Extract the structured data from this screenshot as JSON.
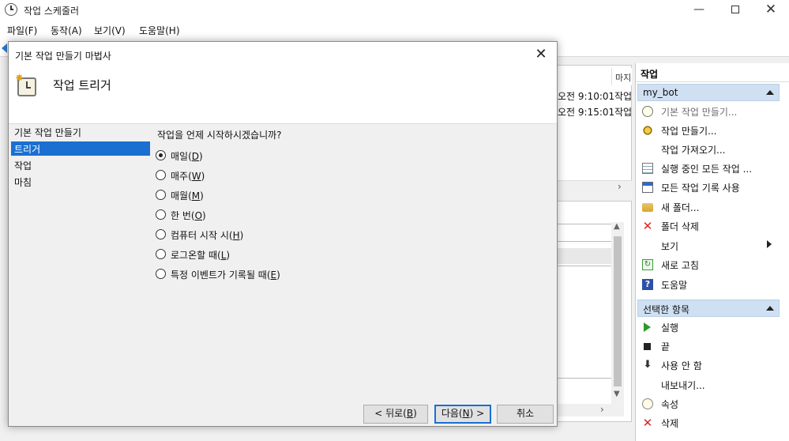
{
  "window": {
    "title": "작업 스케줄러",
    "minimize": "—",
    "maximize": "",
    "close": "✕"
  },
  "menu": [
    "파일(F)",
    "동작(A)",
    "보기(V)",
    "도움말(H)"
  ],
  "background": {
    "column_head": "마지",
    "rows": [
      {
        "time": "오전 9:10:01",
        "status": "작업"
      },
      {
        "time": "오전 9:15:01",
        "status": "작업"
      }
    ],
    "scroll_right": "›",
    "scroll_up": "▲",
    "scroll_down": "▼"
  },
  "actions": {
    "title": "작업",
    "group1": "my_bot",
    "items1": [
      {
        "label": "기본 작업 만들기...",
        "icon": "clock-icon",
        "disabled": true
      },
      {
        "label": "작업 만들기...",
        "icon": "gear-icon"
      },
      {
        "label": "작업 가져오기...",
        "icon": ""
      },
      {
        "label": "실행 중인 모든 작업 ...",
        "icon": "list-icon"
      },
      {
        "label": "모든 작업 기록 사용",
        "icon": "document-icon"
      },
      {
        "label": "새 폴더...",
        "icon": "folder-icon"
      },
      {
        "label": "폴더 삭제",
        "icon": "delete-x-icon"
      },
      {
        "label": "보기",
        "icon": "",
        "submenu": true
      },
      {
        "label": "새로 고침",
        "icon": "refresh-icon"
      },
      {
        "label": "도움말",
        "icon": "help-icon"
      }
    ],
    "group2": "선택한 항목",
    "items2": [
      {
        "label": "실행",
        "icon": "play-icon"
      },
      {
        "label": "끝",
        "icon": "stop-icon"
      },
      {
        "label": "사용 안 함",
        "icon": "down-arrow-icon"
      },
      {
        "label": "내보내기...",
        "icon": ""
      },
      {
        "label": "속성",
        "icon": "properties-icon"
      },
      {
        "label": "삭제",
        "icon": "delete-x-icon"
      }
    ]
  },
  "dialog": {
    "title": "기본 작업 만들기 마법사",
    "close": "✕",
    "header_title": "작업 트리거",
    "steps": [
      "기본 작업 만들기",
      "트리거",
      "작업",
      "마침"
    ],
    "active_step": 1,
    "question": "작업을 언제 시작하시겠습니까?",
    "options": [
      {
        "label": "매일(",
        "key": "D",
        "end": ")",
        "checked": true
      },
      {
        "label": "매주(",
        "key": "W",
        "end": ")",
        "checked": false
      },
      {
        "label": "매월(",
        "key": "M",
        "end": ")",
        "checked": false
      },
      {
        "label": "한 번(",
        "key": "O",
        "end": ")",
        "checked": false
      },
      {
        "label": "컴퓨터 시작 시(",
        "key": "H",
        "end": ")",
        "checked": false
      },
      {
        "label": "로그온할 때(",
        "key": "L",
        "end": ")",
        "checked": false
      },
      {
        "label": "특정 이벤트가 기록될 때(",
        "key": "E",
        "end": ")",
        "checked": false
      }
    ],
    "buttons": {
      "back_pre": "< 뒤로(",
      "back_key": "B",
      "back_post": ")",
      "next_pre": "다음(",
      "next_key": "N",
      "next_post": ") >",
      "cancel": "취소"
    }
  }
}
